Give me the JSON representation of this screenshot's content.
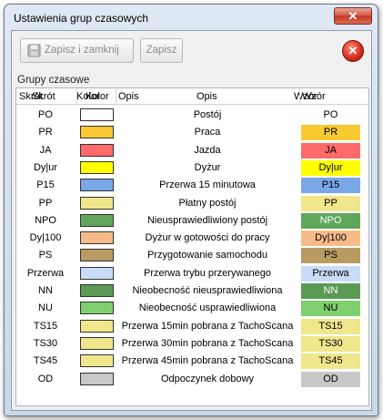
{
  "window": {
    "title": "Ustawienia grup czasowych",
    "close_glyph": "✕"
  },
  "toolbar": {
    "save_close_label": "Zapisz i zamknij",
    "save_label": "Zapisz",
    "save_icon": "floppy-disk-icon",
    "cancel_icon": "cancel-circle-icon",
    "cancel_glyph": "✕"
  },
  "group": {
    "label": "Grupy czasowe"
  },
  "columns": {
    "code_a": "Skrót",
    "code_b": "Skrót",
    "color_a": "Kolor",
    "color_b": "Kolor",
    "desc_a": "Opis",
    "desc_b": "Opis",
    "pattern_a": "Wzór",
    "pattern_b": "Wzór"
  },
  "rows": [
    {
      "code": "PO",
      "color": "#ffffff",
      "desc": "Postój",
      "pattern": "PO",
      "pattern_bg": "#ffffff",
      "pattern_fg": "#000000"
    },
    {
      "code": "PR",
      "color": "#f9c932",
      "desc": "Praca",
      "pattern": "PR",
      "pattern_bg": "#f9c932",
      "pattern_fg": "#000000"
    },
    {
      "code": "JA",
      "color": "#ff6a6a",
      "desc": "Jazda",
      "pattern": "JA",
      "pattern_bg": "#ff6a6a",
      "pattern_fg": "#000000"
    },
    {
      "code": "Dy|ur",
      "color": "#ffff00",
      "desc": "Dyżur",
      "pattern": "Dy|ur",
      "pattern_bg": "#ffff00",
      "pattern_fg": "#000000"
    },
    {
      "code": "P15",
      "color": "#7aa7e6",
      "desc": "Przerwa 15 minutowa",
      "pattern": "P15",
      "pattern_bg": "#7aa7e6",
      "pattern_fg": "#000000"
    },
    {
      "code": "PP",
      "color": "#f0e68c",
      "desc": "Płatny postój",
      "pattern": "PP",
      "pattern_bg": "#f0e68c",
      "pattern_fg": "#000000"
    },
    {
      "code": "NPO",
      "color": "#5fa65a",
      "desc": "Nieusprawiedliwiony postój",
      "pattern": "NPO",
      "pattern_bg": "#5fa65a",
      "pattern_fg": "#ffffff"
    },
    {
      "code": "Dy|100",
      "color": "#f7bb8a",
      "desc": "Dyżur w gotowości do pracy",
      "pattern": "Dy|100",
      "pattern_bg": "#f7bb8a",
      "pattern_fg": "#000000"
    },
    {
      "code": "PS",
      "color": "#b99a62",
      "desc": "Przygotowanie samochodu",
      "pattern": "PS",
      "pattern_bg": "#b99a62",
      "pattern_fg": "#000000"
    },
    {
      "code": "Przerwa",
      "color": "#c9dcf7",
      "desc": "Przerwa trybu przerywanego",
      "pattern": "Przerwa",
      "pattern_bg": "#c9dcf7",
      "pattern_fg": "#000000"
    },
    {
      "code": "NN",
      "color": "#5a9a55",
      "desc": "Nieobecność nieusprawiedliwiona",
      "pattern": "NN",
      "pattern_bg": "#5a9a55",
      "pattern_fg": "#ffffff"
    },
    {
      "code": "NU",
      "color": "#7fcf6f",
      "desc": "Nieobecność usprawiedliwiona",
      "pattern": "NU",
      "pattern_bg": "#7fcf6f",
      "pattern_fg": "#000000"
    },
    {
      "code": "TS15",
      "color": "#f0e68c",
      "desc": "Przerwa 15min pobrana z TachoScana",
      "pattern": "TS15",
      "pattern_bg": "#f0e68c",
      "pattern_fg": "#000000"
    },
    {
      "code": "TS30",
      "color": "#f0e68c",
      "desc": "Przerwa 30min pobrana z TachoScana",
      "pattern": "TS30",
      "pattern_bg": "#f0e68c",
      "pattern_fg": "#000000"
    },
    {
      "code": "TS45",
      "color": "#f0e68c",
      "desc": "Przerwa 45min pobrana z TachoScana",
      "pattern": "TS45",
      "pattern_bg": "#f0e68c",
      "pattern_fg": "#000000"
    },
    {
      "code": "OD",
      "color": "#c8c8c8",
      "desc": "Odpoczynek dobowy",
      "pattern": "OD",
      "pattern_bg": "#c8c8c8",
      "pattern_fg": "#000000"
    }
  ]
}
